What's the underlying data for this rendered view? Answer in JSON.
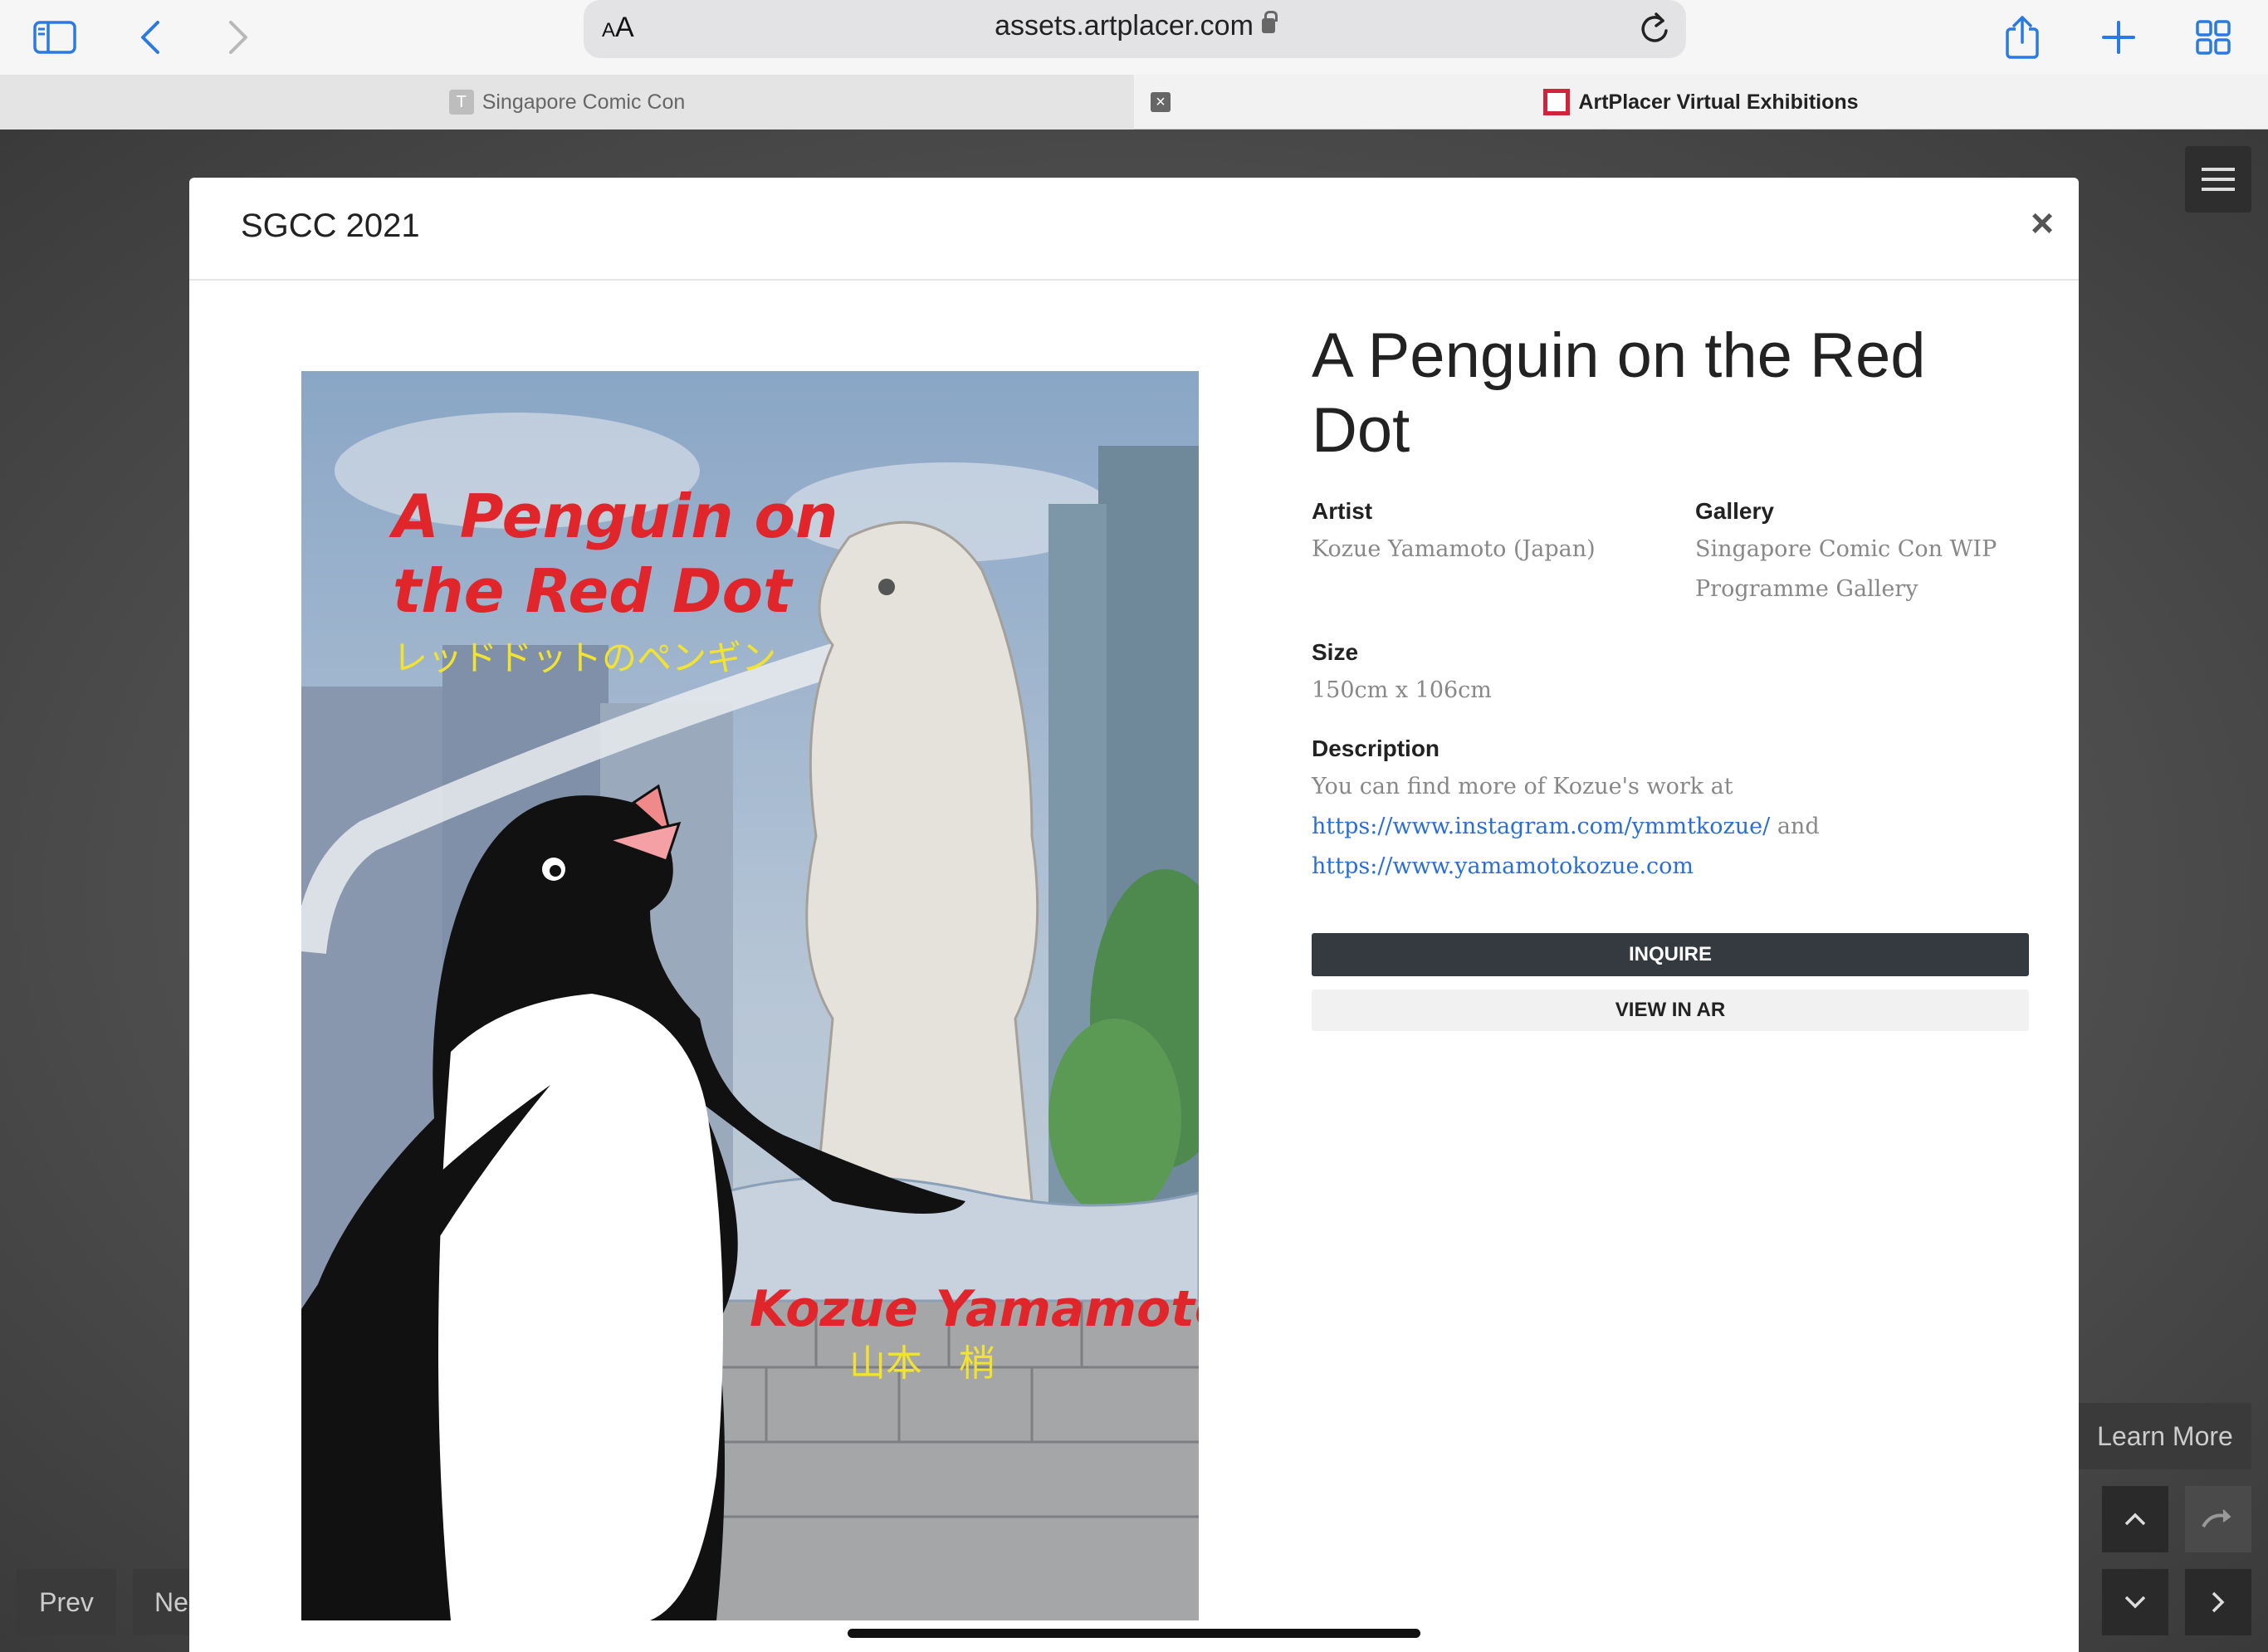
{
  "browser": {
    "aa_small": "A",
    "aa_large": "A",
    "url": "assets.artplacer.com",
    "tabs": [
      {
        "favicon_letter": "T",
        "label": "Singapore Comic Con"
      },
      {
        "close_glyph": "×",
        "label": "ArtPlacer Virtual Exhibitions"
      }
    ]
  },
  "page": {
    "learn_more": "Learn More",
    "prev": "Prev",
    "next": "Ne",
    "up_glyph": "⌃",
    "down_glyph": "⌄",
    "right_glyph": "›"
  },
  "modal": {
    "title": "SGCC 2021",
    "close_glyph": "×"
  },
  "artwork": {
    "cover_title_line1": "A Penguin on",
    "cover_title_line2": "the Red Dot",
    "cover_title_jp": "レッドドットのペンギン",
    "cover_artist": "Kozue Yamamoto",
    "cover_artist_jp": "山本　梢"
  },
  "info": {
    "title": "A Penguin on the Red Dot",
    "artist_label": "Artist",
    "artist_value": "Kozue Yamamoto (Japan)",
    "gallery_label": "Gallery",
    "gallery_value": "Singapore Comic Con WIP Programme Gallery",
    "size_label": "Size",
    "size_value": "150cm x 106cm",
    "description_label": "Description",
    "description_text": "You can find more of Kozue's work at",
    "link1": "https://www.instagram.com/ymmtkozue/",
    "and": "and",
    "link2": "https://www.yamamotokozue.com",
    "inquire": "INQUIRE",
    "view_ar": "VIEW IN AR"
  },
  "colors": {
    "accent_blue": "#2a6fd6",
    "inquire_bg": "#343a40",
    "cover_red": "#e0262b",
    "cover_yellow": "#f2e330"
  }
}
